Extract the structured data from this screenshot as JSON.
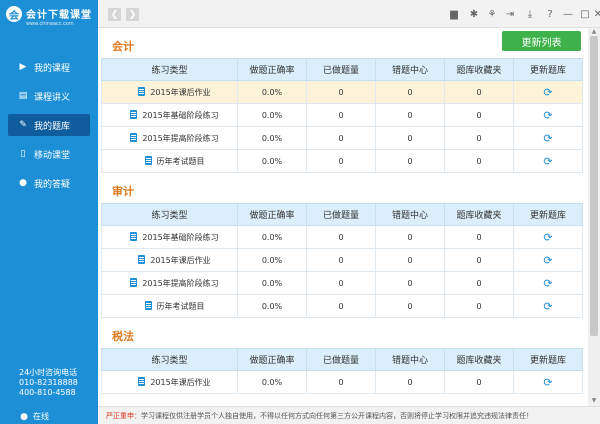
{
  "logo": {
    "mark": "会",
    "title": "会计下载课堂",
    "subtitle": "www.chinaacc.com"
  },
  "sidebar": {
    "items": [
      {
        "label": "我的课程",
        "icon": "play-circle-icon",
        "glyph": "▶"
      },
      {
        "label": "课程讲义",
        "icon": "book-icon",
        "glyph": "▤"
      },
      {
        "label": "我的题库",
        "icon": "pencil-icon",
        "glyph": "✎"
      },
      {
        "label": "移动课堂",
        "icon": "phone-icon",
        "glyph": "▯"
      },
      {
        "label": "我的答疑",
        "icon": "user-icon",
        "glyph": "●"
      }
    ],
    "contact_title": "24小时咨询电话",
    "phone1": "010-82318888",
    "phone2": "400-810-4588",
    "online_label": "在线"
  },
  "toolbar": {
    "back": "❮",
    "forward": "❯",
    "icons": [
      {
        "name": "message-icon",
        "glyph": "▆"
      },
      {
        "name": "gear-icon",
        "glyph": "✱"
      },
      {
        "name": "shirt-icon",
        "glyph": "⚘"
      },
      {
        "name": "login-icon",
        "glyph": "⇥"
      },
      {
        "name": "download-icon",
        "glyph": "⤓"
      },
      {
        "name": "help-icon",
        "glyph": "?"
      },
      {
        "name": "minimize-icon",
        "glyph": "—"
      },
      {
        "name": "maximize-icon",
        "glyph": "□"
      },
      {
        "name": "close-icon",
        "glyph": "✕"
      }
    ]
  },
  "main": {
    "refresh_button": "更新列表",
    "headers": [
      "练习类型",
      "做题正确率",
      "已做题量",
      "错题中心",
      "题库收藏夹",
      "更新题库"
    ],
    "sections": [
      {
        "title": "会计",
        "rows": [
          {
            "type": "2015年课后作业",
            "rate": "0.0%",
            "done": "0",
            "wrong": "0",
            "fav": "0"
          },
          {
            "type": "2015年基础阶段练习",
            "rate": "0.0%",
            "done": "0",
            "wrong": "0",
            "fav": "0"
          },
          {
            "type": "2015年提高阶段练习",
            "rate": "0.0%",
            "done": "0",
            "wrong": "0",
            "fav": "0"
          },
          {
            "type": "历年考试题目",
            "rate": "0.0%",
            "done": "0",
            "wrong": "0",
            "fav": "0"
          }
        ]
      },
      {
        "title": "审计",
        "rows": [
          {
            "type": "2015年基础阶段练习",
            "rate": "0.0%",
            "done": "0",
            "wrong": "0",
            "fav": "0"
          },
          {
            "type": "2015年课后作业",
            "rate": "0.0%",
            "done": "0",
            "wrong": "0",
            "fav": "0"
          },
          {
            "type": "2015年提高阶段练习",
            "rate": "0.0%",
            "done": "0",
            "wrong": "0",
            "fav": "0"
          },
          {
            "type": "历年考试题目",
            "rate": "0.0%",
            "done": "0",
            "wrong": "0",
            "fav": "0"
          }
        ]
      },
      {
        "title": "税法",
        "rows": [
          {
            "type": "2015年课后作业",
            "rate": "0.0%",
            "done": "0",
            "wrong": "0",
            "fav": "0"
          }
        ]
      }
    ],
    "sync_glyph": "⟳"
  },
  "footer": {
    "warning": "严正重申：",
    "text": "学习课程仅供注册学员个人独自使用，不得以任何方式向任何第三方公开课程内容，否则将停止学习权限并追究违规法律责任！"
  },
  "colors": {
    "sidebar": "#1d8fd6",
    "accent": "#e07a1f",
    "button": "#3fb14b",
    "highlight": "#fdf3d8"
  }
}
